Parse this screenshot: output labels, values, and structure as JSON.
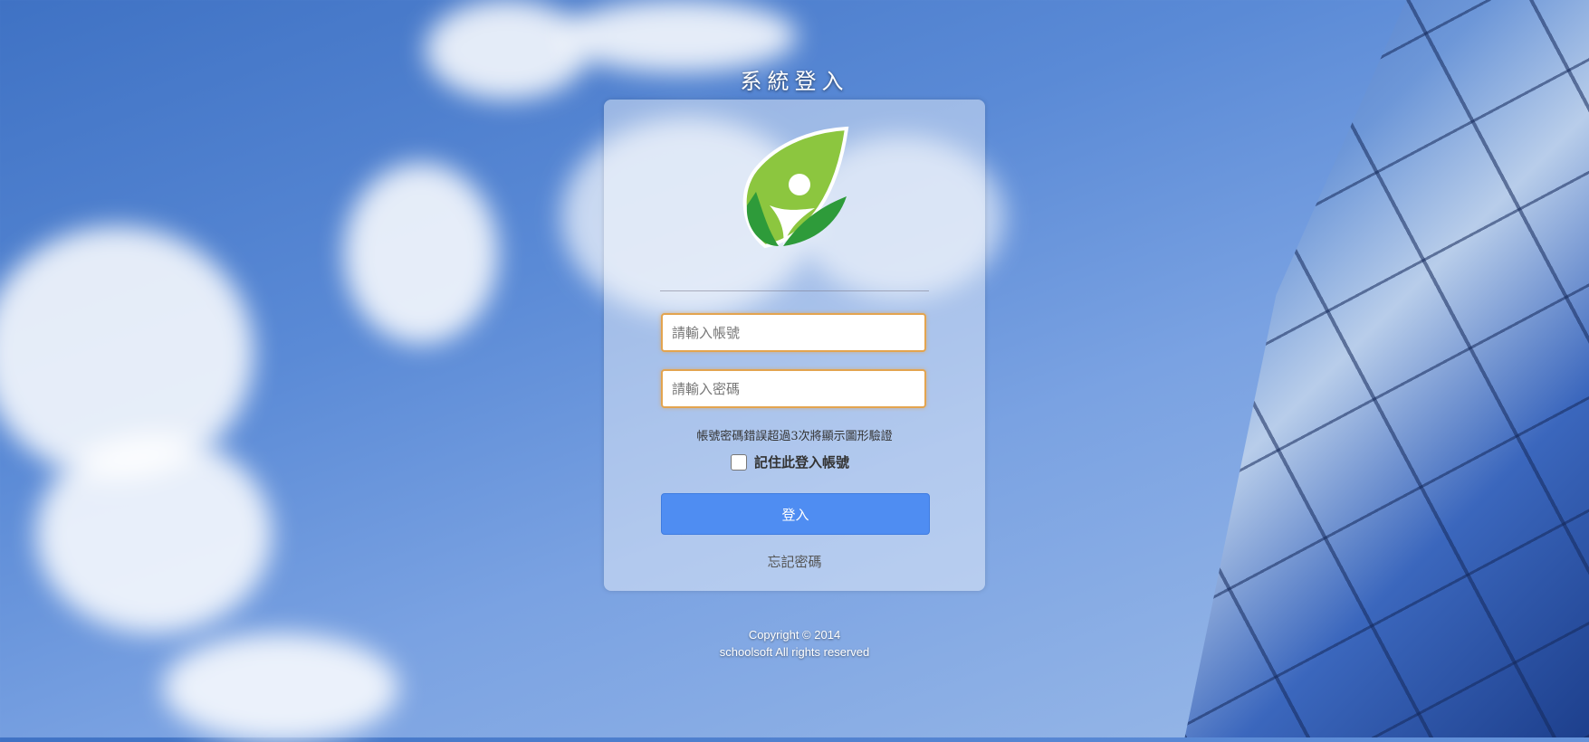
{
  "page": {
    "title": "系統登入"
  },
  "login_form": {
    "logo_icon": "school-leaf-logo-icon",
    "username_placeholder": "請輸入帳號",
    "username_value": "",
    "password_placeholder": "請輸入密碼",
    "password_value": "",
    "hint": "帳號密碼錯誤超過3次將顯示圖形驗證",
    "remember_label": "記住此登入帳號",
    "remember_checked": false,
    "login_button_label": "登入",
    "forgot_link_label": "忘記密碼"
  },
  "footer": {
    "copyright": "Copyright © 2014",
    "rights": "schoolsoft All rights reserved"
  },
  "colors": {
    "primary_button": "#4f8df2",
    "input_border": "#e3a44f",
    "logo_green_light": "#8cc63f",
    "logo_green_dark": "#2e9b3a"
  }
}
